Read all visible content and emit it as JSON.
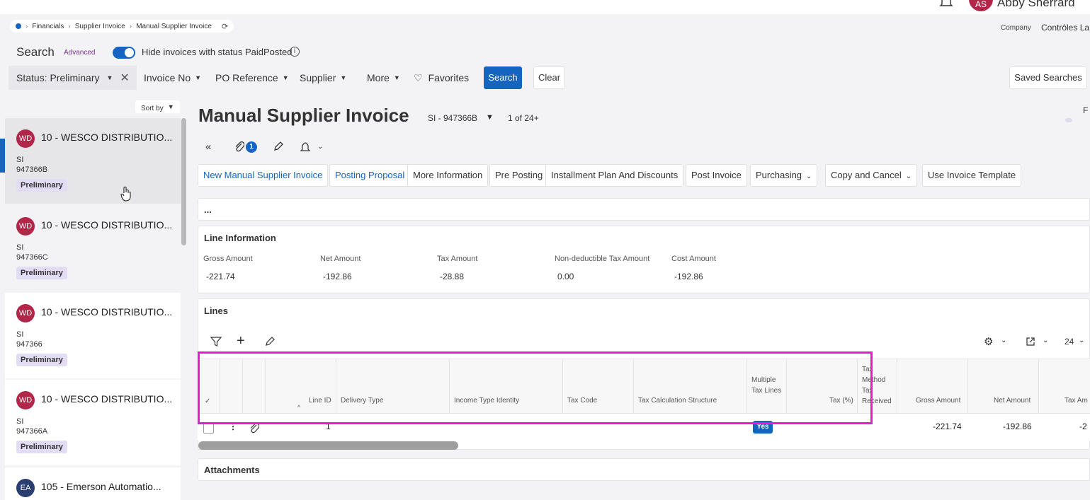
{
  "header": {
    "user_initials": "AS",
    "user_name": "Abby Sherrard",
    "company_label": "Company",
    "company_value": "Contrôles La"
  },
  "breadcrumb": [
    "Financials",
    "Supplier Invoice",
    "Manual Supplier Invoice"
  ],
  "search": {
    "title": "Search",
    "advanced": "Advanced",
    "toggle_label": "Hide invoices with status PaidPosted",
    "toggle_on": true,
    "status_chip": "Status: Preliminary",
    "filters": [
      "Invoice No",
      "PO Reference",
      "Supplier",
      "More"
    ],
    "favorites": "Favorites",
    "search_btn": "Search",
    "clear_btn": "Clear",
    "saved_btn": "Saved Searches"
  },
  "list": {
    "sort_by": "Sort by",
    "items": [
      {
        "initials": "WD",
        "title": "10 - WESCO DISTRIBUTIO...",
        "type": "SI",
        "number": "947366B",
        "status": "Preliminary",
        "avatar_color": "#b1274a"
      },
      {
        "initials": "WD",
        "title": "10 - WESCO DISTRIBUTIO...",
        "type": "SI",
        "number": "947366C",
        "status": "Preliminary",
        "avatar_color": "#b1274a"
      },
      {
        "initials": "WD",
        "title": "10 - WESCO DISTRIBUTIO...",
        "type": "SI",
        "number": "947366",
        "status": "Preliminary",
        "avatar_color": "#b1274a"
      },
      {
        "initials": "WD",
        "title": "10 - WESCO DISTRIBUTIO...",
        "type": "SI",
        "number": "947366A",
        "status": "Preliminary",
        "avatar_color": "#b1274a"
      },
      {
        "initials": "EA",
        "title": "105 - Emerson Automatio...",
        "type": "",
        "number": "",
        "status": "",
        "avatar_color": "#2b3e72"
      }
    ]
  },
  "record": {
    "title": "Manual Supplier Invoice",
    "id": "SI - 947366B",
    "count": "1 of 24+",
    "attachments": "1",
    "right_cut": "F"
  },
  "commands": [
    "New Manual Supplier Invoice",
    "Posting Proposal",
    "More Information",
    "Pre Posting",
    "Installment Plan And Discounts",
    "Post Invoice",
    "Purchasing",
    "Copy and Cancel",
    "Use Invoice Template"
  ],
  "ellipsis_card": "...",
  "line_info": {
    "title": "Line Information",
    "fields": [
      {
        "label": "Gross Amount",
        "value": "-221.74"
      },
      {
        "label": "Net Amount",
        "value": "-192.86"
      },
      {
        "label": "Tax Amount",
        "value": "-28.88"
      },
      {
        "label": "Non-deductible Tax Amount",
        "value": "0.00"
      },
      {
        "label": "Cost Amount",
        "value": "-192.86"
      }
    ]
  },
  "lines": {
    "title": "Lines",
    "page_size": "24",
    "columns": [
      "Line ID",
      "Delivery Type",
      "Income Type Identity",
      "Tax Code",
      "Tax Calculation Structure",
      "Multiple Tax Lines",
      "Tax (%)",
      "Tax Method Tax Received",
      "Gross Amount",
      "Net Amount",
      "Tax Am"
    ],
    "row": {
      "line_id": "1",
      "multiple_tax_lines": "Yes",
      "gross_amount": "-221.74",
      "net_amount": "-192.86",
      "tax_amount": "-2"
    }
  },
  "attachments_card": "Attachments"
}
